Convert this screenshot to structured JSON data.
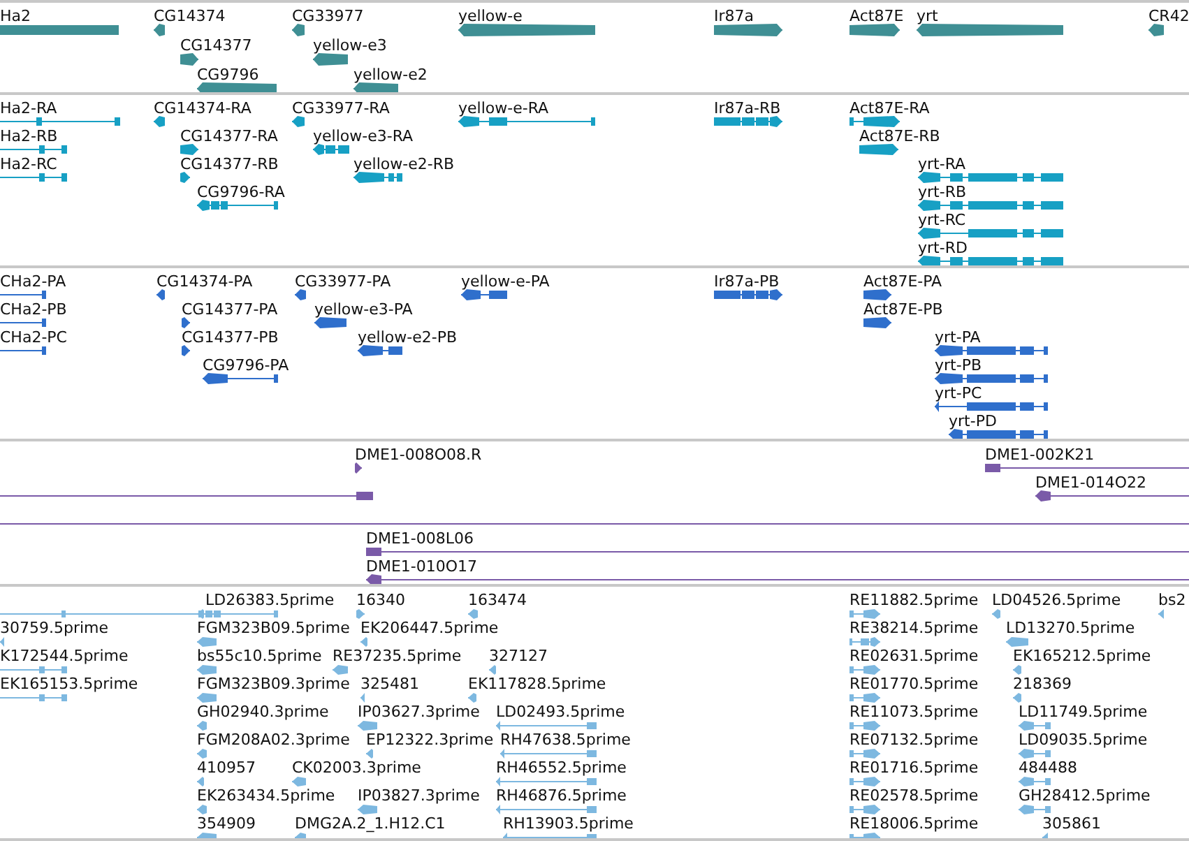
{
  "tracks": [
    {
      "kind": "gene",
      "features": [
        {
          "label": "Ha2"
        },
        {
          "label": "CG14374"
        },
        {
          "label": "CG33977"
        },
        {
          "label": "yellow-e"
        },
        {
          "label": "Ir87a"
        },
        {
          "label": "Act87E"
        },
        {
          "label": "yrt"
        },
        {
          "label": "CR42"
        },
        {
          "label": "CG14377"
        },
        {
          "label": "yellow-e3"
        },
        {
          "label": "CG9796"
        },
        {
          "label": "yellow-e2"
        }
      ]
    },
    {
      "kind": "transcript",
      "features": [
        {
          "label": "Ha2-RA"
        },
        {
          "label": "CG14374-RA"
        },
        {
          "label": "CG33977-RA"
        },
        {
          "label": "yellow-e-RA"
        },
        {
          "label": "Ir87a-RB"
        },
        {
          "label": "Act87E-RA"
        },
        {
          "label": "Ha2-RB"
        },
        {
          "label": "CG14377-RA"
        },
        {
          "label": "yellow-e3-RA"
        },
        {
          "label": "Act87E-RB"
        },
        {
          "label": "Ha2-RC"
        },
        {
          "label": "CG14377-RB"
        },
        {
          "label": "yellow-e2-RB"
        },
        {
          "label": "yrt-RA"
        },
        {
          "label": "CG9796-RA"
        },
        {
          "label": "yrt-RB"
        },
        {
          "label": "yrt-RC"
        },
        {
          "label": "yrt-RD"
        }
      ]
    },
    {
      "kind": "protein",
      "features": [
        {
          "label": "CHa2-PA"
        },
        {
          "label": "CG14374-PA"
        },
        {
          "label": "CG33977-PA"
        },
        {
          "label": "yellow-e-PA"
        },
        {
          "label": "Ir87a-PB"
        },
        {
          "label": "Act87E-PA"
        },
        {
          "label": "CHa2-PB"
        },
        {
          "label": "CG14377-PA"
        },
        {
          "label": "yellow-e3-PA"
        },
        {
          "label": "Act87E-PB"
        },
        {
          "label": "CHa2-PC"
        },
        {
          "label": "CG14377-PB"
        },
        {
          "label": "yellow-e2-PB"
        },
        {
          "label": "yrt-PA"
        },
        {
          "label": "CG9796-PA"
        },
        {
          "label": "yrt-PB"
        },
        {
          "label": "yrt-PC"
        },
        {
          "label": "yrt-PD"
        }
      ]
    },
    {
      "kind": "clone",
      "features": [
        {
          "label": "DME1-008O08.R"
        },
        {
          "label": "DME1-002K21"
        },
        {
          "label": "DME1-014O22"
        },
        {
          "label": "DME1-008L06"
        },
        {
          "label": "DME1-010O17"
        }
      ]
    },
    {
      "kind": "est",
      "features": [
        {
          "label": "LD26383.5prime"
        },
        {
          "label": "16340"
        },
        {
          "label": "163474"
        },
        {
          "label": "RE11882.5prime"
        },
        {
          "label": "LD04526.5prime"
        },
        {
          "label": "bs2"
        },
        {
          "label": "30759.5prime"
        },
        {
          "label": "FGM323B09.5prime"
        },
        {
          "label": "EK206447.5prime"
        },
        {
          "label": "RE38214.5prime"
        },
        {
          "label": "LD13270.5prime"
        },
        {
          "label": "K172544.5prime"
        },
        {
          "label": "bs55c10.5prime"
        },
        {
          "label": "RE37235.5prime"
        },
        {
          "label": "327127"
        },
        {
          "label": "RE02631.5prime"
        },
        {
          "label": "EK165212.5prime"
        },
        {
          "label": "EK165153.5prime"
        },
        {
          "label": "FGM323B09.3prime"
        },
        {
          "label": "325481"
        },
        {
          "label": "EK117828.5prime"
        },
        {
          "label": "RE01770.5prime"
        },
        {
          "label": "218369"
        },
        {
          "label": "GH02940.3prime"
        },
        {
          "label": "IP03627.3prime"
        },
        {
          "label": "LD02493.5prime"
        },
        {
          "label": "RE11073.5prime"
        },
        {
          "label": "LD11749.5prime"
        },
        {
          "label": "FGM208A02.3prime"
        },
        {
          "label": "EP12322.3prime"
        },
        {
          "label": "RH47638.5prime"
        },
        {
          "label": "RE07132.5prime"
        },
        {
          "label": "LD09035.5prime"
        },
        {
          "label": "410957"
        },
        {
          "label": "CK02003.3prime"
        },
        {
          "label": "RH46552.5prime"
        },
        {
          "label": "RE01716.5prime"
        },
        {
          "label": "484488"
        },
        {
          "label": "EK263434.5prime"
        },
        {
          "label": "IP03827.3prime"
        },
        {
          "label": "RH46876.5prime"
        },
        {
          "label": "RE02578.5prime"
        },
        {
          "label": "GH28412.5prime"
        },
        {
          "label": "354909"
        },
        {
          "label": "DMG2A.2_1.H12.C1"
        },
        {
          "label": "RH13903.5prime"
        },
        {
          "label": "RE18006.5prime"
        },
        {
          "label": "305861"
        }
      ]
    }
  ]
}
